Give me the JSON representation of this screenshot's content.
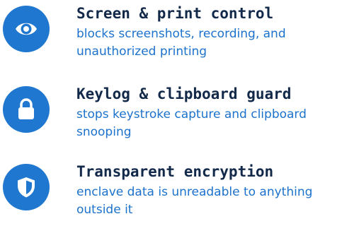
{
  "colors": {
    "icon_bg": "#1f77d0",
    "title": "#12294a",
    "description": "#1c72cc"
  },
  "features": [
    {
      "icon": "eye-icon",
      "title": "Screen & print control",
      "description": "blocks screenshots, recording, and unauthorized printing"
    },
    {
      "icon": "lock-icon",
      "title": "Keylog & clipboard guard",
      "description": "stops keystroke capture and clipboard snooping"
    },
    {
      "icon": "shield-icon",
      "title": "Transparent encryption",
      "description": "enclave data is unreadable to anything outside it"
    }
  ]
}
